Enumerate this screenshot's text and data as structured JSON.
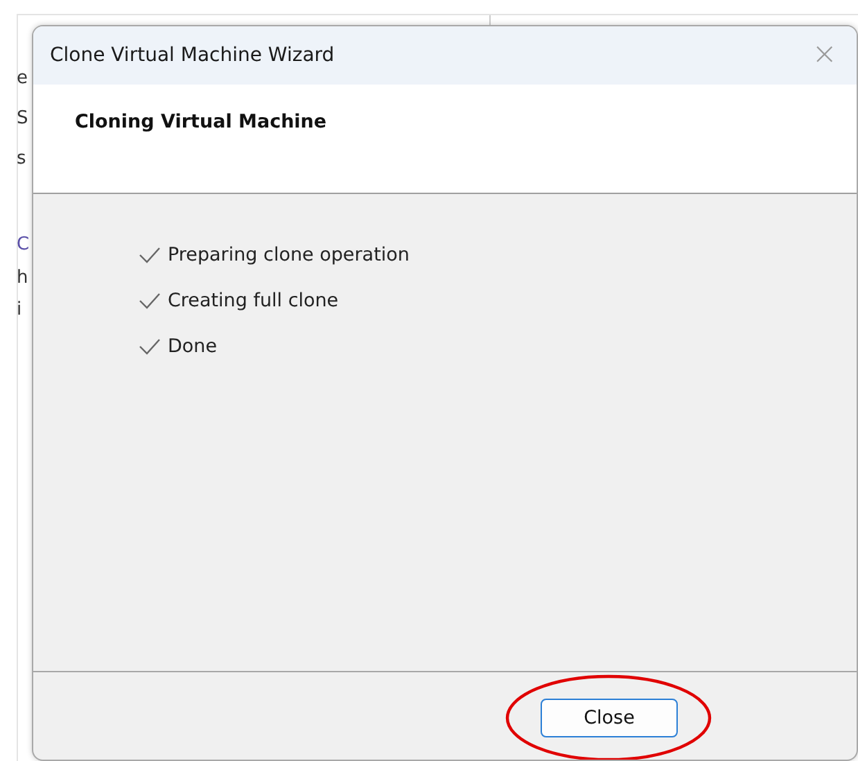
{
  "background_window": {
    "rows": [
      {
        "kind": "text",
        "column_1": "e"
      },
      {
        "kind": "text",
        "column_1": "S"
      },
      {
        "kind": "text",
        "column_1": "s"
      },
      {
        "kind": "link",
        "column_1": "C"
      },
      {
        "kind": "text",
        "column_1": "h"
      },
      {
        "kind": "text",
        "column_1": "i"
      }
    ]
  },
  "dialog": {
    "title": "Clone Virtual Machine Wizard",
    "close_glyph": "×",
    "heading": "Cloning Virtual Machine",
    "steps": [
      {
        "label": "Preparing clone operation",
        "done": true
      },
      {
        "label": "Creating full clone",
        "done": true
      },
      {
        "label": "Done",
        "done": true
      }
    ],
    "buttons": [
      {
        "label": "Close",
        "highlighted": true
      }
    ]
  }
}
